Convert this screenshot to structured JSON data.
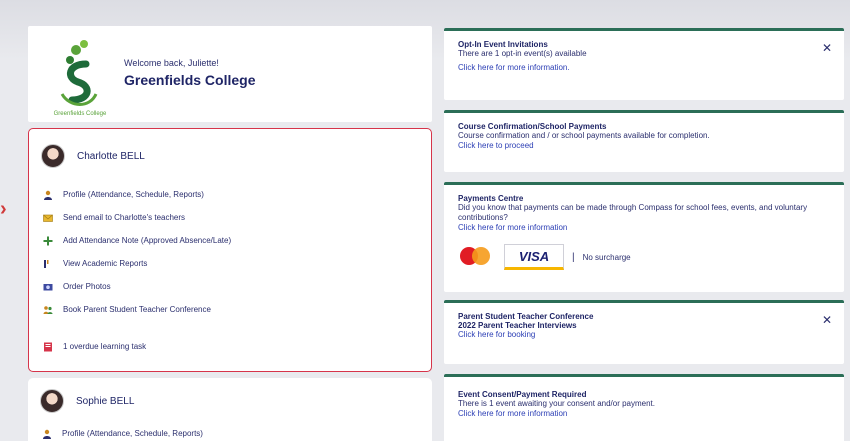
{
  "background_text": "",
  "welcome": {
    "greeting": "Welcome back, Juliette!",
    "school": "Greenfields College",
    "logo_caption": "Greenfields College"
  },
  "students": [
    {
      "name": "Charlotte BELL",
      "menu": [
        {
          "icon": "person-icon",
          "label": "Profile (Attendance, Schedule, Reports)"
        },
        {
          "icon": "envelope-icon",
          "label": "Send email to Charlotte's teachers"
        },
        {
          "icon": "plus-icon",
          "label": "Add Attendance Note (Approved Absence/Late)"
        },
        {
          "icon": "report-icon",
          "label": "View Academic Reports"
        },
        {
          "icon": "photo-icon",
          "label": "Order Photos"
        },
        {
          "icon": "conference-icon",
          "label": "Book Parent Student Teacher Conference"
        },
        {
          "icon": "overdue-icon",
          "label": "1 overdue learning task"
        }
      ]
    },
    {
      "name": "Sophie BELL",
      "menu": [
        {
          "icon": "person-icon",
          "label": "Profile (Attendance, Schedule, Reports)"
        }
      ]
    }
  ],
  "cards": {
    "optin": {
      "title": "Opt-In Event Invitations",
      "body": "There are 1 opt-in event(s) available",
      "link": "Click here for more information."
    },
    "course": {
      "title": "Course Confirmation/School Payments",
      "body": "Course confirmation and / or school payments available for completion.",
      "link": "Click here to proceed"
    },
    "payments": {
      "title": "Payments Centre",
      "body": "Did you know that payments can be made through Compass for school fees, events, and voluntary contributions?",
      "link": "Click here for more information",
      "visa": "VISA",
      "separator": "|",
      "surcharge": "No surcharge"
    },
    "conference": {
      "title": "Parent Student Teacher Conference",
      "subtitle": "2022 Parent Teacher Interviews",
      "link": "Click here for booking"
    },
    "consent": {
      "title": "Event Consent/Payment Required",
      "body": "There is 1 event awaiting your consent and/or payment.",
      "link": "Click here for more information"
    }
  },
  "close_symbol": "✕",
  "colors": {
    "accent_green": "#2b6e57",
    "highlight_red": "#d6344a",
    "link_blue": "#2c3fb5",
    "text_navy": "#1f2566"
  }
}
